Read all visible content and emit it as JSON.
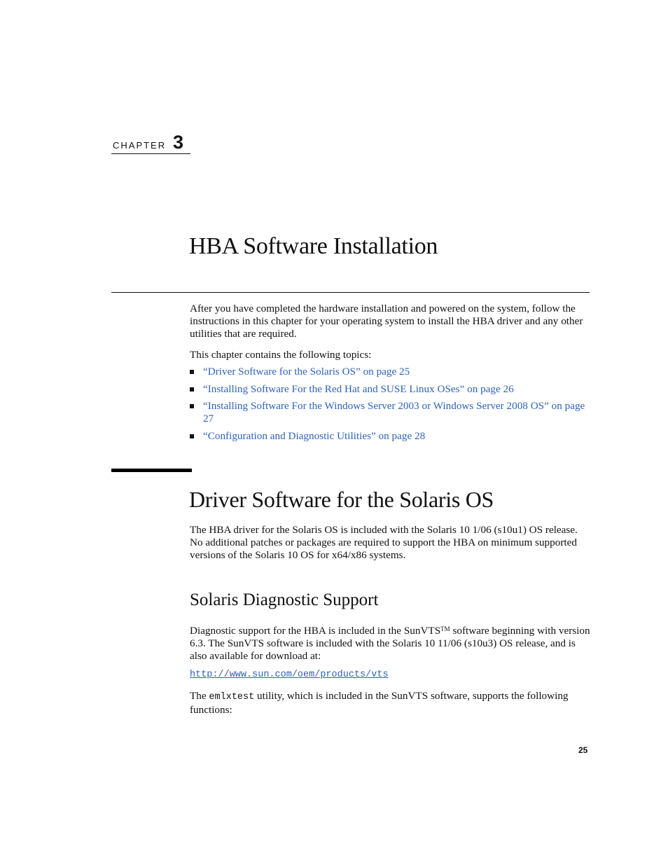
{
  "chapter": {
    "label": "CHAPTER",
    "number": "3",
    "title": "HBA Software Installation"
  },
  "intro": {
    "paragraph": "After you have completed the hardware installation and powered on the system, follow the instructions in this chapter for your operating system to install the HBA driver and any other utilities that are required.",
    "topics_lead": "This chapter contains the following topics:",
    "topics": [
      {
        "label": "“Driver Software for the Solaris OS” on page 25"
      },
      {
        "label": "“Installing Software For the Red Hat and SUSE Linux OSes” on page 26"
      },
      {
        "label": "“Installing Software For the Windows Server 2003 or Windows Server 2008 OS” on page 27"
      },
      {
        "label": "“Configuration and Diagnostic Utilities” on page 28"
      }
    ]
  },
  "section": {
    "title": "Driver Software for the Solaris OS",
    "paragraph": "The HBA driver for the Solaris OS is included with the Solaris 10 1/06 (s10u1) OS release. No additional patches or packages are required to support the HBA on minimum supported versions of the Solaris 10 OS for x64/x86 systems."
  },
  "subsection": {
    "title": "Solaris Diagnostic Support",
    "para1_part1": "Diagnostic support for the HBA is included in the SunVTS",
    "trademark": "TM",
    "para1_part2": " software beginning with version 6.3. The SunVTS software is included with the Solaris 10 11/06 (s10u3) OS release, and is also available for download at:",
    "url": "http://www.sun.com/oem/products/vts",
    "para2_prefix": "The ",
    "para2_code": "emlxtest",
    "para2_suffix": " utility, which is included in the SunVTS software, supports the following functions:"
  },
  "footer": {
    "page_number": "25"
  }
}
